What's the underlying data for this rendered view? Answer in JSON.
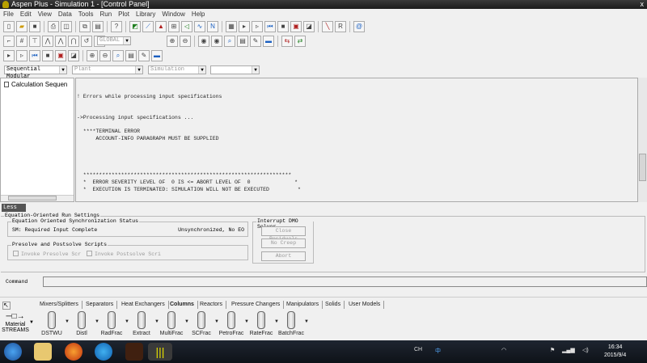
{
  "window": {
    "title": "Aspen Plus - Simulation 1 - [Control Panel]",
    "close": "x"
  },
  "menu": [
    "File",
    "Edit",
    "View",
    "Data",
    "Tools",
    "Run",
    "Plot",
    "Library",
    "Window",
    "Help"
  ],
  "toolbar": {
    "global_combo": "GLOBAL",
    "mode_combo": "Sequential Modular",
    "plant_combo": "Plant",
    "simulation_combo": "Simulation",
    "empty_combo": ""
  },
  "tree": {
    "item": "Calculation Sequen"
  },
  "messages": {
    "line1": "! Errors while processing input specifications",
    "line2": "->Processing input specifications ...",
    "line3": "  ****TERMINAL ERROR",
    "line4": "      ACCOUNT-INFO PARAGRAPH MUST BE SUPPLIED",
    "line5": "  ******************************************************************",
    "line6": "  *  ERROR SEVERITY LEVEL OF  0 IS <= ABORT LEVEL OF  0              *",
    "line7": "  *  EXECUTION IS TERMINATED: SIMULATION WILL NOT BE EXECUTED         *"
  },
  "less_button": "Less ≪",
  "eo": {
    "title": "Equation-Oriented Run Settings",
    "sync_title": "Equation Oriented Synchronization Status",
    "sm_status": "SM: Required Input Complete",
    "sync_status": "Unsynchronized, No EO",
    "scripts_title": "Presolve and Postsolve Scripts",
    "presolve": "Invoke Presolve Scr",
    "postsolve": "Invoke Postsolve Scri",
    "interrupt_title": "Interrupt DMO Solver",
    "close_residuals": "Close Residuals",
    "no_creep": "No Creep",
    "abort": "Abort"
  },
  "command_label": "Command",
  "palette": {
    "tabs": [
      "Mixers/Splitters",
      "Separators",
      "Heat Exchangers",
      "Columns",
      "Reactors",
      "Pressure Changers",
      "Manipulators",
      "Solids",
      "User Models"
    ],
    "active_tab": "Columns",
    "stream_label": "Material",
    "streams_label": "STREAMS",
    "items": [
      "DSTWU",
      "Distl",
      "RadFrac",
      "Extract",
      "MultiFrac",
      "SCFrac",
      "PetroFrac",
      "RateFrac",
      "BatchFrac"
    ]
  },
  "taskbar": {
    "lang": "CH",
    "ime": "中",
    "time": "16:34",
    "date": "2015/9/4"
  }
}
